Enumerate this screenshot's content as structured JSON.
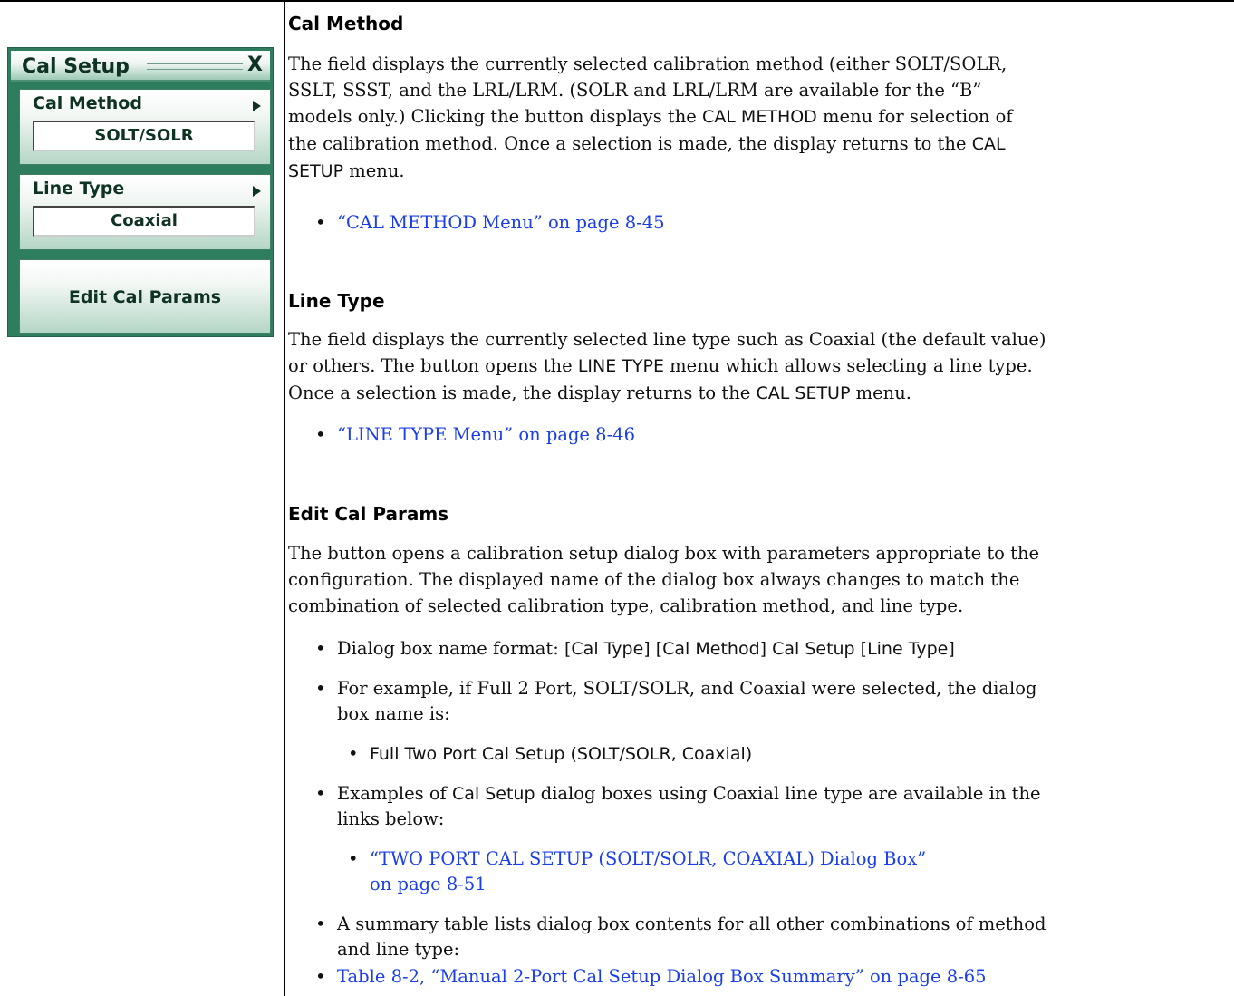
{
  "menu": {
    "title": "Cal Setup",
    "close_label": "X",
    "cal_method": {
      "label": "Cal Method",
      "value": "SOLT/SOLR"
    },
    "line_type": {
      "label": "Line Type",
      "value": "Coaxial"
    },
    "edit_button": "Edit Cal Params"
  },
  "sections": {
    "cal_method": {
      "heading": "Cal Method",
      "p_a": "The field displays the currently selected calibration method (either SOLT/SOLR,",
      "p_b": "SSLT, SSST, and the LRL/LRM. (SOLR and LRL/LRM are available for the “B”",
      "p_c": "models only.) Clicking the button displays the ",
      "p_c_sans": "CAL METHOD",
      "p_c_tail": " menu for selection of",
      "p_d": "the calibration method. Once a selection is made, the display returns to the ",
      "p_d_sans": "CAL",
      "p_e_sans": "SETUP",
      "p_e_tail": " menu.",
      "link": "“CAL METHOD Menu” on page 8-45"
    },
    "line_type": {
      "heading": "Line Type",
      "p_a": "The field displays the currently selected line type such as Coaxial (the default value)",
      "p_b": "or others. The button opens the ",
      "p_b_sans": "LINE TYPE",
      "p_b_tail": " menu which allows selecting a line type.",
      "p_c": "Once a selection is made, the display returns to the ",
      "p_c_sans": "CAL SETUP",
      "p_c_tail": " menu.",
      "link": "“LINE TYPE Menu” on page 8-46"
    },
    "edit_cal": {
      "heading": "Edit Cal Params",
      "p_a": "The button opens a calibration setup dialog box with parameters appropriate to the",
      "p_b": "configuration. The displayed name of the dialog box always changes to match the",
      "p_c": "combination of selected calibration type, calibration method, and line type.",
      "b1_lead": "Dialog box name format: ",
      "b1_sans": "[Cal Type] [Cal Method] Cal Setup [Line Type]",
      "b2_a": "For example, if Full 2 Port, SOLT/SOLR, and Coaxial were selected, the dialog",
      "b2_b": "box name is:",
      "b2_sub": "Full Two Port Cal Setup (SOLT/SOLR, Coaxial)",
      "b3_lead": "Examples of ",
      "b3_sans": "Cal Setup",
      "b3_tail": " dialog boxes using Coaxial line type are available in the",
      "b3_b": "links below:",
      "b3_link_a": "“TWO PORT CAL SETUP (SOLT/SOLR, COAXIAL) Dialog Box”",
      "b3_link_b": "on page 8-51",
      "b4_a": "A summary table lists dialog box contents for all other combinations of method",
      "b4_b": "and line type:",
      "b5_link": "Table 8-2, “Manual 2-Port Cal Setup Dialog Box Summary” on page 8-65"
    }
  },
  "bullet_glyph": "•"
}
